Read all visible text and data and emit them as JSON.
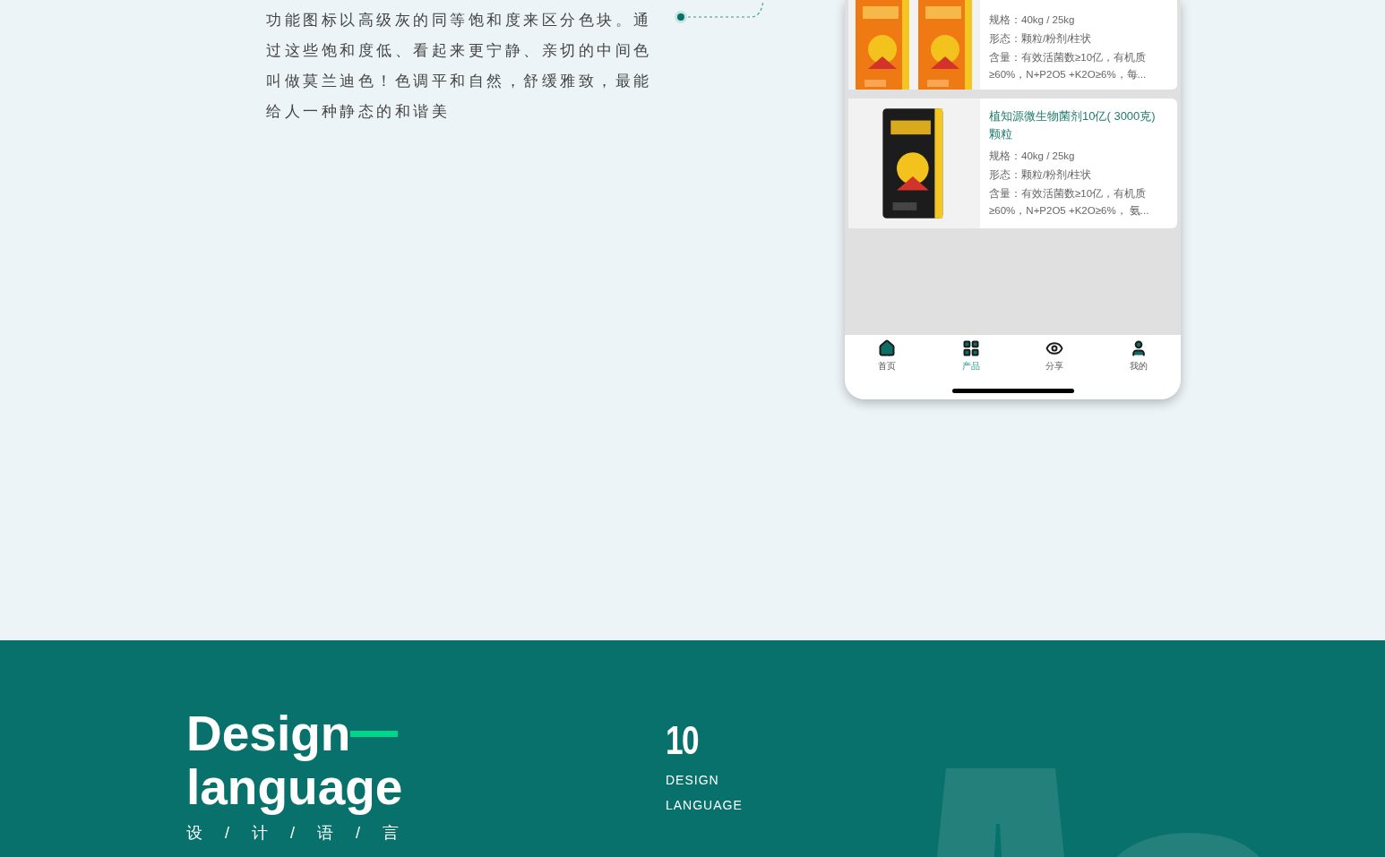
{
  "description": {
    "text": "功能图标以高级灰的同等饱和度来区分色块。通过这些饱和度低、看起来更宁静、亲切的中间色叫做莫兰迪色！色调平和自然，舒缓雅致，最能给人一种静态的和谐美"
  },
  "phone": {
    "products": [
      {
        "specs": [
          "规格：40kg / 25kg",
          "形态：颗粒/粉剂/柱状",
          "含量：有效活菌数≥10亿，有机质",
          "≥60%，N+P2O5 +K2O≥6%，每..."
        ]
      },
      {
        "title": "植知源微生物菌剂10亿( 3000克)颗粒",
        "specs": [
          "规格：40kg / 25kg",
          "形态：颗粒/粉剂/柱状",
          "含量：有效活菌数≥10亿，有机质",
          "≥60%，N+P2O5 +K2O≥6%， 氨..."
        ]
      }
    ],
    "tabs": [
      {
        "label": "首页",
        "selected": false
      },
      {
        "label": "产品",
        "selected": true
      },
      {
        "label": "分享",
        "selected": false
      },
      {
        "label": "我的",
        "selected": false
      }
    ]
  },
  "section": {
    "title_lines": [
      "Design",
      "language"
    ],
    "subtitle": "设 / 计 / 语 / 言",
    "number": "10",
    "label_lines": [
      "DESIGN",
      "LANGUAGE"
    ]
  }
}
